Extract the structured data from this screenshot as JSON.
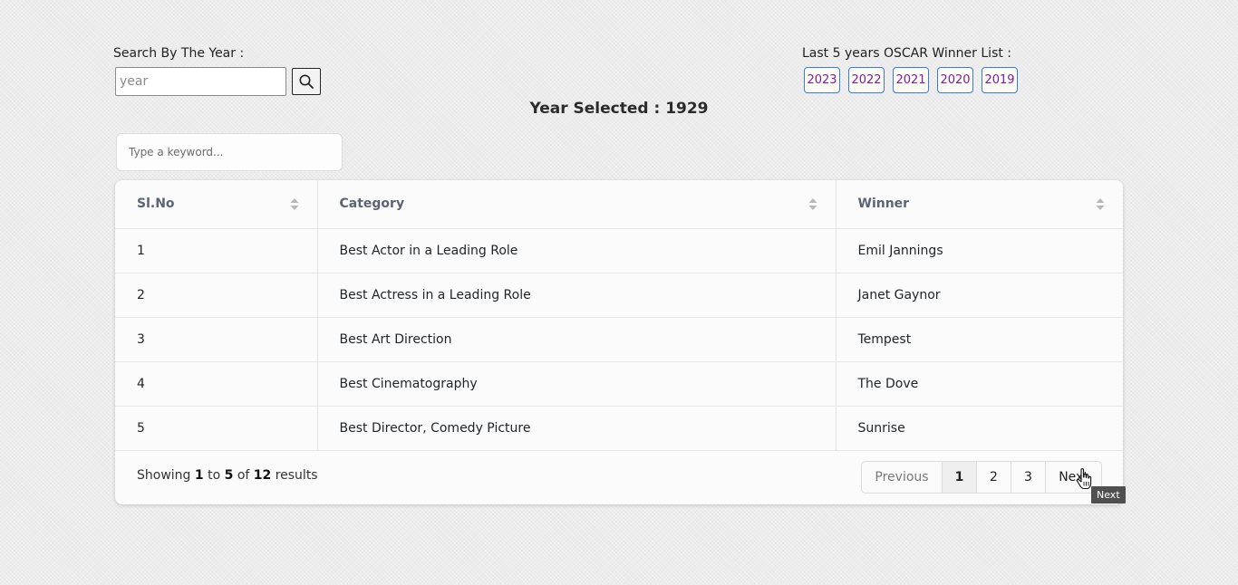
{
  "search": {
    "label": "Search By The Year :",
    "placeholder": "year",
    "value": "",
    "button_icon": "search-icon"
  },
  "oscar_list": {
    "label": "Last 5 years OSCAR Winner List :",
    "years": [
      "2023",
      "2022",
      "2021",
      "2020",
      "2019"
    ]
  },
  "selected_year": {
    "text": "Year Selected : 1929"
  },
  "keyword_filter": {
    "placeholder": "Type a keyword..."
  },
  "table": {
    "headers": [
      "Sl.No",
      "Category",
      "Winner"
    ],
    "rows": [
      [
        "1",
        "Best Actor in a Leading Role",
        "Emil Jannings"
      ],
      [
        "2",
        "Best Actress in a Leading Role",
        "Janet Gaynor"
      ],
      [
        "3",
        "Best Art Direction",
        "Tempest"
      ],
      [
        "4",
        "Best Cinematography",
        "The Dove"
      ],
      [
        "5",
        "Best Director, Comedy Picture",
        "Sunrise"
      ]
    ]
  },
  "footer": {
    "showing_prefix": "Showing",
    "from": "1",
    "to_word": "to",
    "to": "5",
    "of_word": "of",
    "total": "12",
    "suffix": "results"
  },
  "pagination": {
    "previous": "Previous",
    "pages": [
      "1",
      "2",
      "3"
    ],
    "active_page": "1",
    "next": "Next"
  },
  "tooltip": {
    "text": "Next"
  },
  "colors": {
    "year_button_border": "#3a7bd5",
    "year_button_text": "#7a1fa2",
    "header_text": "#5b6472"
  }
}
